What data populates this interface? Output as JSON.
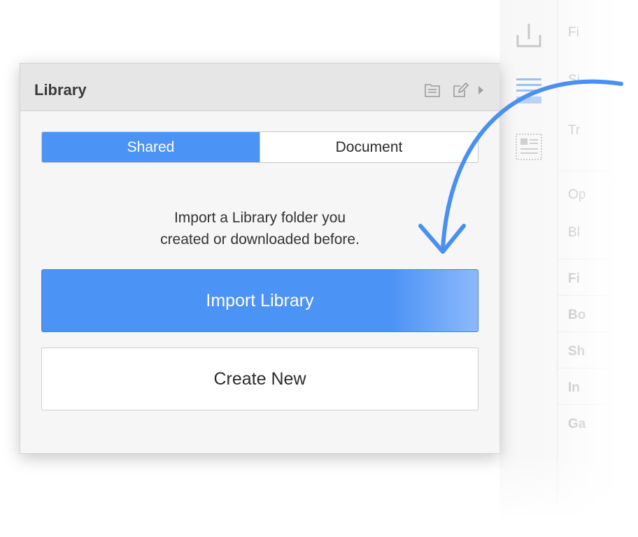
{
  "colors": {
    "accent": "#4c93f6",
    "arrow": "#4a8ff3"
  },
  "library_panel": {
    "title": "Library",
    "header_icons": [
      "folder-icon",
      "edit-icon",
      "disclosure-triangle-icon"
    ],
    "tabs": [
      {
        "label": "Shared",
        "active": true
      },
      {
        "label": "Document",
        "active": false
      }
    ],
    "hint_line1": "Import a Library folder you",
    "hint_line2": "created or downloaded before.",
    "import_button_label": "Import Library",
    "create_button_label": "Create New"
  },
  "inspector": {
    "labels": [
      "Fi",
      "Si",
      "Tr",
      "Op",
      "Bl",
      "Fi",
      "Bo",
      "Sh",
      "In",
      "Ga"
    ],
    "icons": [
      "export-icon",
      "align-text-icon",
      "layout-icon"
    ]
  }
}
